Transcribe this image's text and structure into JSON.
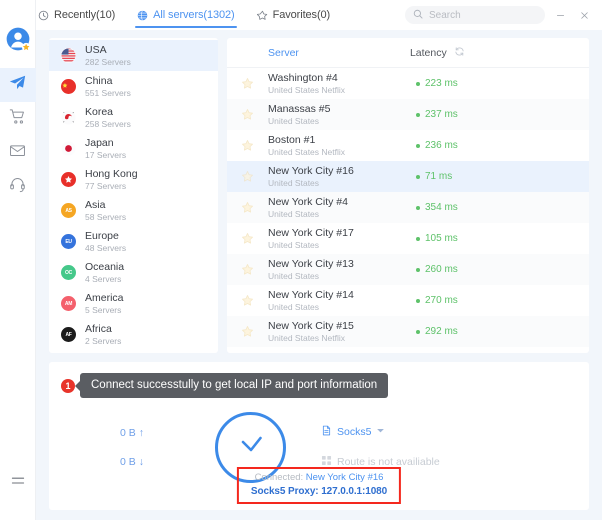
{
  "window": {
    "minimize_label": "minimize-window",
    "close_label": "close-window"
  },
  "tabs": [
    {
      "id": "recently",
      "label": "Recently(10)",
      "icon": "clock-icon",
      "active": false
    },
    {
      "id": "all-servers",
      "label": "All servers(1302)",
      "icon": "globe-icon",
      "active": true
    },
    {
      "id": "favorites",
      "label": "Favorites(0)",
      "icon": "star-icon",
      "active": false
    }
  ],
  "search": {
    "placeholder": "Search",
    "value": "",
    "icon": "search-icon"
  },
  "rail": {
    "items": [
      {
        "id": "account",
        "icon": "user-avatar-icon",
        "active": false
      },
      {
        "id": "servers",
        "icon": "paper-plane-icon",
        "active": true
      },
      {
        "id": "store",
        "icon": "shopping-cart-icon",
        "active": false
      },
      {
        "id": "mail",
        "icon": "envelope-icon",
        "active": false
      },
      {
        "id": "support",
        "icon": "headset-icon",
        "active": false
      },
      {
        "id": "menu",
        "icon": "hamburger-menu-icon",
        "active": false
      }
    ]
  },
  "countries": [
    {
      "name": "USA",
      "count": "282 Servers",
      "flag": "flag-usa",
      "color": "#d8dce8",
      "abbr": "",
      "selected": true
    },
    {
      "name": "China",
      "count": "551 Servers",
      "flag": "flag-china",
      "color": "#e8302a",
      "abbr": "",
      "selected": false
    },
    {
      "name": "Korea",
      "count": "258 Servers",
      "flag": "flag-korea",
      "color": "#f4f5f7",
      "abbr": "",
      "selected": false
    },
    {
      "name": "Japan",
      "count": "17 Servers",
      "flag": "flag-japan",
      "color": "#ffffff",
      "abbr": "",
      "selected": false
    },
    {
      "name": "Hong Kong",
      "count": "77 Servers",
      "flag": "flag-hongkong",
      "color": "#e8302a",
      "abbr": "",
      "selected": false
    },
    {
      "name": "Asia",
      "count": "58 Servers",
      "flag": "region-asia",
      "color": "#f5a623",
      "abbr": "AS",
      "selected": false
    },
    {
      "name": "Europe",
      "count": "48 Servers",
      "flag": "region-europe",
      "color": "#3573dc",
      "abbr": "EU",
      "selected": false
    },
    {
      "name": "Oceania",
      "count": "4 Servers",
      "flag": "region-oceania",
      "color": "#45c88a",
      "abbr": "OC",
      "selected": false
    },
    {
      "name": "America",
      "count": "5 Servers",
      "flag": "region-america",
      "color": "#f4606c",
      "abbr": "AM",
      "selected": false
    },
    {
      "name": "Africa",
      "count": "2 Servers",
      "flag": "region-africa",
      "color": "#1c1c1c",
      "abbr": "AF",
      "selected": false
    }
  ],
  "table": {
    "columns": {
      "server": "Server",
      "latency": "Latency"
    },
    "refresh_icon": "refresh-icon",
    "rows": [
      {
        "name": "Washington #4",
        "sub": "United States Netflix",
        "latency": "223 ms",
        "selected": false
      },
      {
        "name": "Manassas #5",
        "sub": "United States",
        "latency": "237 ms",
        "selected": false
      },
      {
        "name": "Boston #1",
        "sub": "United States Netflix",
        "latency": "236 ms",
        "selected": false
      },
      {
        "name": "New York City #16",
        "sub": "United States",
        "latency": "71 ms",
        "selected": true
      },
      {
        "name": "New York City #4",
        "sub": "United States",
        "latency": "354 ms",
        "selected": false
      },
      {
        "name": "New York City #17",
        "sub": "United States",
        "latency": "105 ms",
        "selected": false
      },
      {
        "name": "New York City #13",
        "sub": "United States",
        "latency": "260 ms",
        "selected": false
      },
      {
        "name": "New York City #14",
        "sub": "United States",
        "latency": "270 ms",
        "selected": false
      },
      {
        "name": "New York City #15",
        "sub": "United States Netflix",
        "latency": "292 ms",
        "selected": false
      }
    ]
  },
  "bottom": {
    "badge_number": "1",
    "tooltip": "Connect successtully to get local IP and port information",
    "upload": "0 B",
    "download": "0 B",
    "upload_arrow": "↑",
    "download_arrow": "↓",
    "connect_button_icon": "checkmark-circle-icon",
    "proxy_mode": "Socks5",
    "proxy_mode_icon": "document-icon",
    "proxy_dropdown_icon": "chevron-down-icon",
    "route_text": "Route is not availiable",
    "route_icon": "grid-icon",
    "connected_label": "Connected:",
    "connected_server": "New York City #16",
    "proxy_line": "Socks5 Proxy: 127.0.0.1:1080"
  },
  "colors": {
    "accent": "#4d93f0",
    "latency_green": "#5ec26a",
    "alert_red": "#f4281e",
    "tooltip_bg": "#5a5d62"
  }
}
